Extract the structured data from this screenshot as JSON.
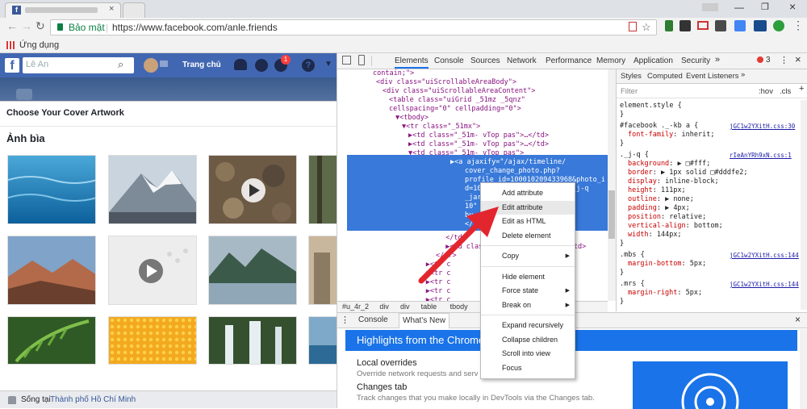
{
  "browser": {
    "tab_title": "",
    "secure_label": "Bảo mật",
    "url": "https://www.facebook.com/anle.friends",
    "apps_label": "Ứng dụng"
  },
  "facebook": {
    "search_value": "Lê An",
    "home_label": "Trang chủ",
    "notif_count": "1",
    "dialog_title": "Choose Your Cover Artwork",
    "section_title": "Ảnh bìa",
    "footer_prefix": "Sống tại",
    "footer_city": "Thành phố Hồ Chí Minh",
    "brand_color": "#4267b2"
  },
  "devtools": {
    "tabs": [
      "Elements",
      "Console",
      "Sources",
      "Network",
      "Performance",
      "Memory",
      "Application",
      "Security"
    ],
    "error_count": "3",
    "elements_lines": [
      {
        "text": "contain;\">",
        "indent": 11
      },
      {
        "text": "<div class=\"uiScrollableAreaBody\">",
        "indent": 12
      },
      {
        "text": "<div class=\"uiScrollableAreaContent\">",
        "indent": 14
      },
      {
        "text": "<table class=\"uiGrid _51mz _5qnz\"",
        "indent": 16
      },
      {
        "text": "cellspacing=\"0\" cellpadding=\"0\">",
        "indent": 16
      },
      {
        "text": "▼<tbody>",
        "indent": 18
      },
      {
        "text": "▼<tr class=\"_51mx\">",
        "indent": 20
      },
      {
        "text": "▶<td class=\"_51m- vTop pas\">…</td>",
        "indent": 22
      },
      {
        "text": "▶<td class=\"_51m- vTop pas\">…</td>",
        "indent": 22
      },
      {
        "text": "▼<td class=\"_51m- vTop pas\">",
        "indent": 22
      }
    ],
    "selected_lines": [
      "▶<a ajaxify=\"/ajax/timeline/",
      "cover_change_photo.php?",
      "profile_id=100010209433968&photo_i",
      "d=101509148576927\" class=\"_j-q",
      "_jar\" href=\"#\" data-s\" id=\"",
      "10\" role=\"",
      "bu",
      "</"
    ],
    "after_lines": [
      {
        "text": "</td>",
        "indent": 22
      },
      {
        "text": "▶<td class=\"_51m- vTop pas\">…</td>",
        "indent": 22
      },
      {
        "text": "</tr>",
        "indent": 20
      },
      {
        "text": "▶<tr c",
        "indent": 18
      },
      {
        "text": "▶<tr c",
        "indent": 18
      },
      {
        "text": "▶<tr c",
        "indent": 18
      },
      {
        "text": "▶<tr c",
        "indent": 18
      },
      {
        "text": "▶<tr c",
        "indent": 18
      },
      {
        "text": "▶<tr c",
        "indent": 18
      },
      {
        "text": "▶<tr c",
        "indent": 18
      },
      {
        "text": "▶<tr c",
        "indent": 18
      }
    ],
    "crumbs": [
      "#u_4r_2",
      "div",
      "div",
      "table",
      "tbody"
    ],
    "styles_tabs": [
      "Styles",
      "Computed",
      "Event Listeners"
    ],
    "filter_placeholder": "Filter",
    "hov_label": ":hov",
    "cls_label": ".cls",
    "style_rules": [
      {
        "sel": "element.style {",
        "src": ""
      },
      {
        "sel": "}",
        "src": ""
      },
      {
        "sel": "#facebook ._-kb a {",
        "src": "jGC1w2YXitH.css:30"
      },
      {
        "prop": "font-family",
        "val": "inherit;"
      },
      {
        "sel": "}",
        "src": ""
      },
      {
        "sel": "._j-q {",
        "src": "rIeAnYRh9xN.css:1"
      },
      {
        "prop": "background",
        "val": "▶ □#fff;"
      },
      {
        "prop": "border",
        "val": "▶ 1px solid □#dddfe2;"
      },
      {
        "prop": "display",
        "val": "inline-block;"
      },
      {
        "prop": "height",
        "val": "111px;"
      },
      {
        "prop": "outline",
        "val": "▶ none;"
      },
      {
        "prop": "padding",
        "val": "▶ 4px;"
      },
      {
        "prop": "position",
        "val": "relative;"
      },
      {
        "prop": "vertical-align",
        "val": "bottom;"
      },
      {
        "prop": "width",
        "val": "144px;"
      },
      {
        "sel": "}",
        "src": ""
      },
      {
        "sel": ".mbs {",
        "src": "jGC1w2YXitH.css:144"
      },
      {
        "prop": "margin-bottom",
        "val": "5px;"
      },
      {
        "sel": "}",
        "src": ""
      },
      {
        "sel": ".mrs {",
        "src": "jGC1w2YXitH.css:144"
      },
      {
        "prop": "margin-right",
        "val": "5px;"
      },
      {
        "sel": "}",
        "src": ""
      }
    ],
    "drawer_tabs": [
      "Console",
      "What's New"
    ],
    "banner": "Highlights from the Chrome 6",
    "whatsnew": [
      {
        "title": "Local overrides",
        "desc": "Override network requests and serve local resources instead."
      },
      {
        "title": "Changes tab",
        "desc": "Track changes that you make locally in DevTools via the Changes tab."
      }
    ]
  },
  "context_menu": {
    "group1": [
      "Add attribute",
      "Edit attribute",
      "Edit as HTML",
      "Delete element"
    ],
    "group2": [
      "Copy"
    ],
    "group3": [
      "Hide element",
      "Force state",
      "Break on"
    ],
    "group4": [
      "Expand recursively",
      "Collapse children",
      "Scroll into view",
      "Focus"
    ],
    "highlighted": "Edit attribute"
  },
  "colors": {
    "selection": "#3879d9",
    "arrow": "#e3262e",
    "accent": "#1a73e8"
  }
}
